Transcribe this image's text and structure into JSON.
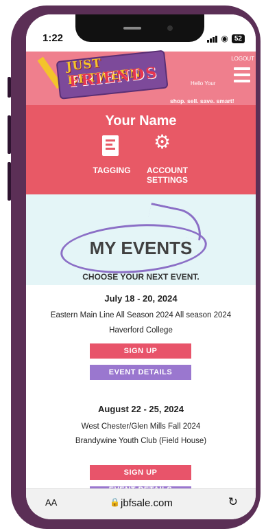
{
  "status": {
    "time": "1:22",
    "battery": "52"
  },
  "header": {
    "logo_line1": "JUST BETWEEN",
    "logo_line2": "FRIENDS",
    "greeting": "Hello Your",
    "logout": "LOGOUT",
    "tagline": "shop. sell. save. smart!"
  },
  "profile": {
    "name": "Your Name",
    "tagging": "TAGGING",
    "account_line1": "ACCOUNT",
    "account_line2": "SETTINGS"
  },
  "events_header": {
    "title": "MY EVENTS",
    "subtitle": "CHOOSE YOUR NEXT EVENT."
  },
  "events": [
    {
      "date": "July 18 - 20, 2024",
      "name": "Eastern Main Line All Season 2024 All season 2024",
      "location": "Haverford College",
      "signup": "SIGN UP",
      "details": "EVENT DETAILS"
    },
    {
      "date": "August 22 - 25, 2024",
      "name": "West Chester/Glen Mills Fall 2024",
      "location": "Brandywine Youth Club (Field House)",
      "signup": "SIGN UP",
      "details": "EVENT DETAILS"
    }
  ],
  "browser": {
    "text_size": "AA",
    "url": "jbfsale.com"
  },
  "colors": {
    "header_pink": "#ef7f8d",
    "profile_red": "#e85966",
    "button_red": "#e8546a",
    "button_purple": "#9a77cf",
    "frame_purple": "#5b2f56"
  }
}
